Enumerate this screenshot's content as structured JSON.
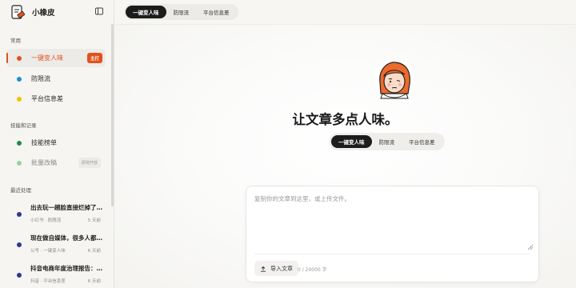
{
  "app": {
    "name": "小橡皮"
  },
  "top_tabs": [
    "一键变人味",
    "防限流",
    "平台信息差"
  ],
  "sidebar": {
    "sections": [
      "常用",
      "技能和记录",
      "最近处理"
    ],
    "common_items": [
      {
        "label": "一键变人味",
        "color": "#e0531f",
        "badge": "主打"
      },
      {
        "label": "防限流",
        "color": "#1a8fd6"
      },
      {
        "label": "平台信息差",
        "color": "#f2c200"
      }
    ],
    "skill_items": [
      {
        "label": "技能榜单",
        "color": "#1f8a4c"
      },
      {
        "label": "批量改稿",
        "color": "#8fd3a8",
        "badge": "即将开放"
      }
    ],
    "recent": [
      {
        "title": "出去玩一趟脸直接烂掉了…",
        "platform": "小红书",
        "tool": "防限流",
        "time": "5 天前"
      },
      {
        "title": "现在做自媒体，很多人都…",
        "platform": "公号",
        "tool": "一键变人味",
        "time": "6 天前"
      },
      {
        "title": "抖音电商年度治理报告：…",
        "platform": "抖音",
        "tool": "平台信息差",
        "time": "6 天前"
      }
    ]
  },
  "main": {
    "headline": "让文章多点人味。",
    "mode_tabs": [
      "一键变人味",
      "防限流",
      "平台信息差"
    ],
    "editor": {
      "placeholder": "复制你的文章到这里，或上传文件。",
      "upload_label": "导入文章",
      "char_count": "0 / 20000 字"
    }
  },
  "icons": [
    "logo-icon",
    "sidebar-toggle-icon",
    "upload-icon",
    "resize-grip-icon",
    "avatar-illustration"
  ]
}
